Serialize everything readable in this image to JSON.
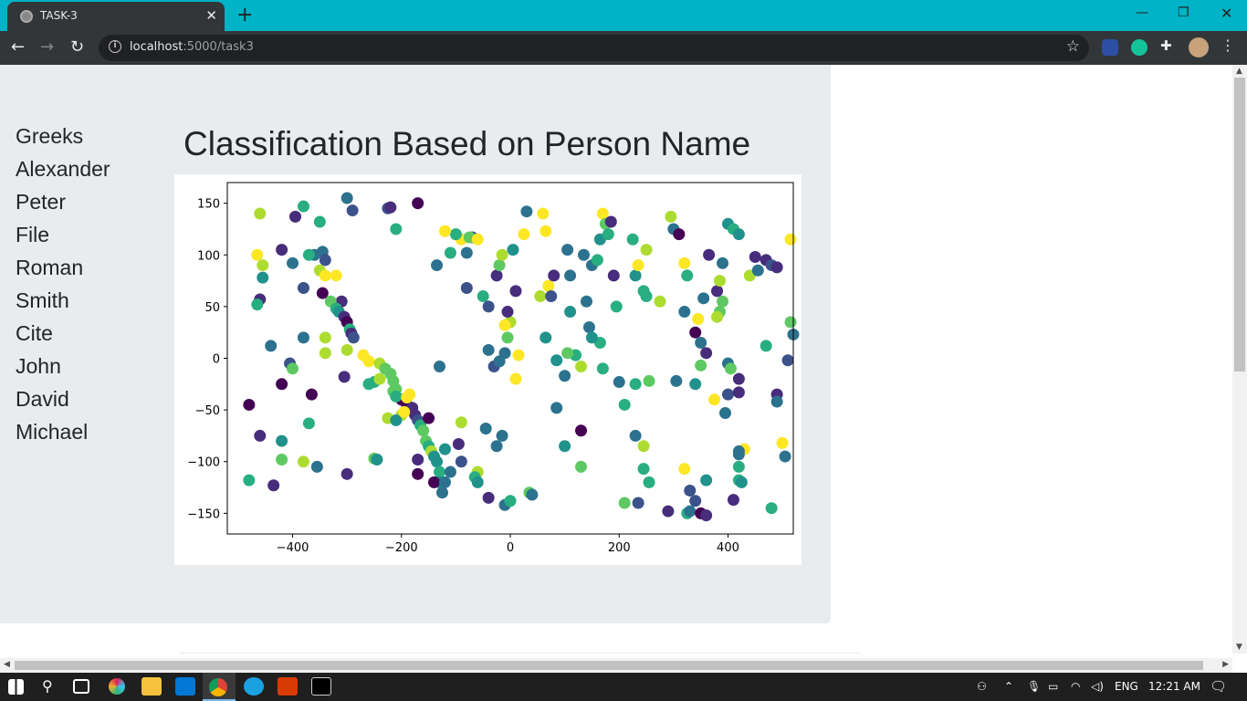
{
  "browser": {
    "tab_title": "TASK-3",
    "url_host": "localhost",
    "url_path": ":5000/task3"
  },
  "sidebar": [
    "Greeks",
    "Alexander",
    "Peter",
    "File",
    "Roman",
    "Smith",
    "Cite",
    "John",
    "David",
    "Michael"
  ],
  "heading": "Classification Based on Person Name",
  "chart_data": {
    "type": "scatter",
    "xlim": [
      -520,
      520
    ],
    "ylim": [
      -170,
      170
    ],
    "xticks": [
      -400,
      -200,
      0,
      200,
      400
    ],
    "xtick_labels": [
      "−400",
      "−200",
      "0",
      "200",
      "400"
    ],
    "yticks": [
      150,
      100,
      50,
      0,
      -50,
      -100,
      -150
    ],
    "ytick_labels": [
      "150",
      "100",
      "50",
      "0",
      "−50",
      "−100",
      "−150"
    ],
    "colormap": "viridis",
    "palette": [
      "#440154",
      "#472d7b",
      "#3b528b",
      "#2c728e",
      "#21918c",
      "#28ae80",
      "#5ec962",
      "#addc30",
      "#fde725"
    ],
    "points": [
      [
        -460,
        140,
        7
      ],
      [
        -380,
        147,
        5
      ],
      [
        -300,
        155,
        3
      ],
      [
        -290,
        143,
        2
      ],
      [
        -225,
        145,
        2
      ],
      [
        -220,
        146,
        1
      ],
      [
        -170,
        150,
        0
      ],
      [
        -350,
        132,
        5
      ],
      [
        -395,
        137,
        1
      ],
      [
        -210,
        125,
        5
      ],
      [
        -465,
        100,
        8
      ],
      [
        -455,
        90,
        7
      ],
      [
        -455,
        78,
        4
      ],
      [
        -420,
        105,
        1
      ],
      [
        -400,
        92,
        3
      ],
      [
        -360,
        100,
        3
      ],
      [
        -345,
        103,
        3
      ],
      [
        -370,
        100,
        5
      ],
      [
        -340,
        95,
        2
      ],
      [
        -350,
        85,
        7
      ],
      [
        -340,
        80,
        8
      ],
      [
        -320,
        80,
        8
      ],
      [
        -310,
        55,
        1
      ],
      [
        -380,
        68,
        2
      ],
      [
        -460,
        57,
        1
      ],
      [
        -465,
        52,
        5
      ],
      [
        -345,
        63,
        0
      ],
      [
        -330,
        55,
        6
      ],
      [
        -320,
        48,
        5
      ],
      [
        -315,
        45,
        4
      ],
      [
        -305,
        40,
        1
      ],
      [
        -300,
        35,
        0
      ],
      [
        -295,
        28,
        5
      ],
      [
        -292,
        24,
        1
      ],
      [
        -288,
        20,
        2
      ],
      [
        -340,
        20,
        7
      ],
      [
        -440,
        12,
        3
      ],
      [
        -380,
        20,
        3
      ],
      [
        -340,
        5,
        7
      ],
      [
        -300,
        8,
        7
      ],
      [
        -270,
        3,
        8
      ],
      [
        -260,
        -3,
        8
      ],
      [
        -240,
        -5,
        7
      ],
      [
        -230,
        -10,
        6
      ],
      [
        -220,
        -15,
        6
      ],
      [
        -215,
        -22,
        6
      ],
      [
        -210,
        -30,
        6
      ],
      [
        -200,
        -40,
        0
      ],
      [
        -190,
        -45,
        0
      ],
      [
        -185,
        -50,
        0
      ],
      [
        -180,
        -48,
        1
      ],
      [
        -175,
        -55,
        1
      ],
      [
        -170,
        -60,
        2
      ],
      [
        -165,
        -65,
        5
      ],
      [
        -160,
        -70,
        6
      ],
      [
        -155,
        -80,
        6
      ],
      [
        -150,
        -85,
        5
      ],
      [
        -145,
        -90,
        7
      ],
      [
        -140,
        -95,
        4
      ],
      [
        -135,
        -100,
        4
      ],
      [
        -130,
        -110,
        5
      ],
      [
        -130,
        -120,
        4
      ],
      [
        -125,
        -130,
        3
      ],
      [
        -405,
        -5,
        2
      ],
      [
        -400,
        -10,
        6
      ],
      [
        -420,
        -25,
        0
      ],
      [
        -365,
        -35,
        0
      ],
      [
        -305,
        -18,
        1
      ],
      [
        -260,
        -25,
        5
      ],
      [
        -250,
        -23,
        5
      ],
      [
        -240,
        -20,
        7
      ],
      [
        -215,
        -32,
        6
      ],
      [
        -210,
        -37,
        5
      ],
      [
        -200,
        -55,
        7
      ],
      [
        -480,
        -45,
        0
      ],
      [
        -460,
        -75,
        1
      ],
      [
        -420,
        -80,
        4
      ],
      [
        -370,
        -63,
        5
      ],
      [
        -380,
        -100,
        7
      ],
      [
        -355,
        -105,
        3
      ],
      [
        -300,
        -112,
        1
      ],
      [
        -250,
        -97,
        6
      ],
      [
        -245,
        -98,
        4
      ],
      [
        -420,
        -98,
        6
      ],
      [
        -480,
        -118,
        5
      ],
      [
        -435,
        -123,
        1
      ],
      [
        -225,
        -58,
        7
      ],
      [
        -210,
        -60,
        4
      ],
      [
        -195,
        -52,
        8
      ],
      [
        -190,
        -38,
        8
      ],
      [
        -185,
        -35,
        8
      ],
      [
        -170,
        -98,
        1
      ],
      [
        -170,
        -112,
        0
      ],
      [
        -140,
        -120,
        0
      ],
      [
        -120,
        -120,
        3
      ],
      [
        -90,
        -100,
        2
      ],
      [
        -110,
        -110,
        3
      ],
      [
        -60,
        -110,
        7
      ],
      [
        -65,
        -115,
        5
      ],
      [
        -60,
        -120,
        4
      ],
      [
        -40,
        -135,
        1
      ],
      [
        -10,
        -142,
        3
      ],
      [
        0,
        -138,
        5
      ],
      [
        35,
        -130,
        6
      ],
      [
        40,
        -132,
        3
      ],
      [
        -15,
        -75,
        3
      ],
      [
        -25,
        -85,
        3
      ],
      [
        -45,
        -68,
        3
      ],
      [
        -90,
        -62,
        7
      ],
      [
        -95,
        -83,
        1
      ],
      [
        -120,
        -88,
        4
      ],
      [
        -150,
        -58,
        0
      ],
      [
        -130,
        -8,
        3
      ],
      [
        -40,
        8,
        3
      ],
      [
        -30,
        -8,
        2
      ],
      [
        -20,
        -3,
        3
      ],
      [
        -10,
        5,
        3
      ],
      [
        -5,
        20,
        6
      ],
      [
        0,
        35,
        7
      ],
      [
        10,
        -20,
        8
      ],
      [
        15,
        3,
        8
      ],
      [
        -10,
        32,
        8
      ],
      [
        -50,
        60,
        5
      ],
      [
        -40,
        50,
        2
      ],
      [
        -25,
        80,
        1
      ],
      [
        -5,
        45,
        1
      ],
      [
        10,
        65,
        1
      ],
      [
        -80,
        68,
        2
      ],
      [
        -90,
        115,
        8
      ],
      [
        -70,
        117,
        2
      ],
      [
        -75,
        117,
        6
      ],
      [
        -60,
        115,
        8
      ],
      [
        -100,
        120,
        5
      ],
      [
        -110,
        102,
        5
      ],
      [
        -80,
        102,
        3
      ],
      [
        -120,
        123,
        8
      ],
      [
        -135,
        90,
        3
      ],
      [
        -20,
        90,
        6
      ],
      [
        -15,
        100,
        7
      ],
      [
        5,
        105,
        4
      ],
      [
        25,
        120,
        8
      ],
      [
        30,
        142,
        3
      ],
      [
        60,
        140,
        8
      ],
      [
        65,
        123,
        8
      ],
      [
        55,
        60,
        7
      ],
      [
        70,
        70,
        8
      ],
      [
        75,
        60,
        2
      ],
      [
        80,
        80,
        1
      ],
      [
        110,
        45,
        4
      ],
      [
        105,
        105,
        3
      ],
      [
        110,
        80,
        3
      ],
      [
        135,
        100,
        3
      ],
      [
        140,
        55,
        3
      ],
      [
        145,
        30,
        3
      ],
      [
        150,
        90,
        3
      ],
      [
        160,
        95,
        5
      ],
      [
        165,
        115,
        4
      ],
      [
        170,
        140,
        8
      ],
      [
        175,
        130,
        6
      ],
      [
        180,
        120,
        5
      ],
      [
        185,
        132,
        1
      ],
      [
        190,
        80,
        1
      ],
      [
        195,
        50,
        5
      ],
      [
        225,
        115,
        5
      ],
      [
        230,
        80,
        4
      ],
      [
        235,
        90,
        8
      ],
      [
        245,
        65,
        5
      ],
      [
        250,
        60,
        5
      ],
      [
        250,
        105,
        7
      ],
      [
        275,
        55,
        7
      ],
      [
        295,
        137,
        7
      ],
      [
        300,
        125,
        3
      ],
      [
        310,
        120,
        0
      ],
      [
        320,
        45,
        3
      ],
      [
        325,
        80,
        5
      ],
      [
        320,
        92,
        8
      ],
      [
        345,
        38,
        8
      ],
      [
        340,
        25,
        0
      ],
      [
        350,
        15,
        3
      ],
      [
        355,
        58,
        3
      ],
      [
        360,
        5,
        1
      ],
      [
        365,
        100,
        1
      ],
      [
        380,
        65,
        1
      ],
      [
        385,
        75,
        7
      ],
      [
        390,
        55,
        6
      ],
      [
        385,
        45,
        6
      ],
      [
        380,
        40,
        7
      ],
      [
        390,
        92,
        3
      ],
      [
        400,
        130,
        4
      ],
      [
        410,
        125,
        5
      ],
      [
        420,
        120,
        4
      ],
      [
        440,
        80,
        7
      ],
      [
        450,
        98,
        1
      ],
      [
        455,
        85,
        3
      ],
      [
        470,
        95,
        1
      ],
      [
        480,
        90,
        2
      ],
      [
        490,
        88,
        1
      ],
      [
        515,
        115,
        8
      ],
      [
        515,
        35,
        6
      ],
      [
        520,
        23,
        3
      ],
      [
        510,
        -2,
        2
      ],
      [
        400,
        -5,
        3
      ],
      [
        405,
        -10,
        6
      ],
      [
        350,
        -7,
        6
      ],
      [
        340,
        -25,
        4
      ],
      [
        305,
        -22,
        3
      ],
      [
        255,
        -22,
        6
      ],
      [
        230,
        -25,
        5
      ],
      [
        210,
        -45,
        5
      ],
      [
        200,
        -23,
        3
      ],
      [
        170,
        -10,
        5
      ],
      [
        165,
        15,
        5
      ],
      [
        150,
        20,
        4
      ],
      [
        130,
        -8,
        7
      ],
      [
        120,
        3,
        5
      ],
      [
        105,
        5,
        6
      ],
      [
        100,
        -17,
        3
      ],
      [
        85,
        -2,
        4
      ],
      [
        65,
        20,
        4
      ],
      [
        100,
        -85,
        4
      ],
      [
        130,
        -70,
        0
      ],
      [
        130,
        -105,
        6
      ],
      [
        85,
        -48,
        3
      ],
      [
        230,
        -75,
        3
      ],
      [
        245,
        -85,
        7
      ],
      [
        245,
        -107,
        5
      ],
      [
        255,
        -120,
        5
      ],
      [
        235,
        -140,
        2
      ],
      [
        210,
        -140,
        6
      ],
      [
        290,
        -148,
        1
      ],
      [
        320,
        -107,
        8
      ],
      [
        330,
        -128,
        2
      ],
      [
        340,
        -138,
        2
      ],
      [
        325,
        -150,
        5
      ],
      [
        330,
        -148,
        3
      ],
      [
        350,
        -150,
        0
      ],
      [
        360,
        -152,
        1
      ],
      [
        360,
        -118,
        4
      ],
      [
        375,
        -40,
        8
      ],
      [
        400,
        -35,
        2
      ],
      [
        420,
        -20,
        1
      ],
      [
        420,
        -33,
        1
      ],
      [
        395,
        -53,
        3
      ],
      [
        430,
        -88,
        8
      ],
      [
        420,
        -90,
        3
      ],
      [
        420,
        -93,
        3
      ],
      [
        420,
        -105,
        5
      ],
      [
        420,
        -118,
        5
      ],
      [
        425,
        -120,
        4
      ],
      [
        410,
        -137,
        1
      ],
      [
        470,
        12,
        5
      ],
      [
        490,
        -35,
        1
      ],
      [
        490,
        -42,
        3
      ],
      [
        500,
        -82,
        8
      ],
      [
        505,
        -95,
        3
      ],
      [
        480,
        -145,
        5
      ]
    ]
  }
}
